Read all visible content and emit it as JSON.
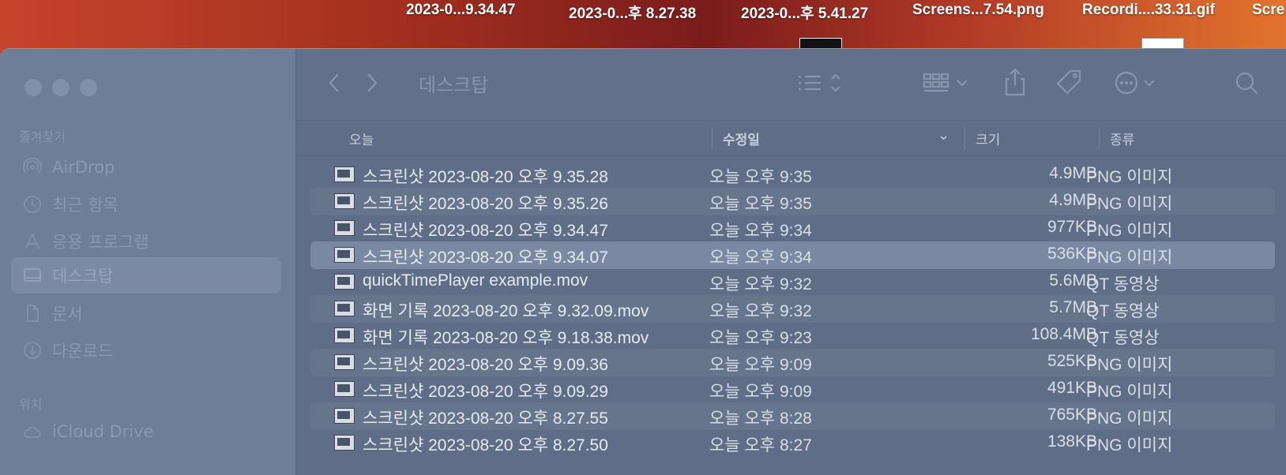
{
  "desktop": {
    "labels": [
      "2023-0...9.34.47",
      "2023-0...후 8.27.38",
      "2023-0...후 5.41.27",
      "Screens...7.54.png",
      "Recordi....33.31.gif",
      "Scre"
    ]
  },
  "sidebar": {
    "favorites_heading": "즐겨찾기",
    "items": [
      {
        "label": "AirDrop",
        "icon": "airdrop-icon"
      },
      {
        "label": "최근 항목",
        "icon": "clock-icon"
      },
      {
        "label": "응용 프로그램",
        "icon": "applications-icon"
      },
      {
        "label": "데스크탑",
        "icon": "desktop-icon",
        "selected": true
      },
      {
        "label": "문서",
        "icon": "document-icon"
      },
      {
        "label": "다운로드",
        "icon": "download-icon"
      }
    ],
    "locations_heading": "위치",
    "locations": [
      {
        "label": "iCloud Drive",
        "icon": "cloud-icon"
      }
    ]
  },
  "toolbar": {
    "title": "데스크탑"
  },
  "columns": {
    "name": "오늘",
    "date": "수정일",
    "size": "크기",
    "kind": "종류"
  },
  "files": [
    {
      "name": "스크린샷 2023-08-20 오후 9.35.28",
      "date": "오늘 오후 9:35",
      "size": "4.9MB",
      "kind": "PNG 이미지"
    },
    {
      "name": "스크린샷 2023-08-20 오후 9.35.26",
      "date": "오늘 오후 9:35",
      "size": "4.9MB",
      "kind": "PNG 이미지"
    },
    {
      "name": "스크린샷 2023-08-20 오후 9.34.47",
      "date": "오늘 오후 9:34",
      "size": "977KB",
      "kind": "PNG 이미지"
    },
    {
      "name": "스크린샷 2023-08-20 오후 9.34.07",
      "date": "오늘 오후 9:34",
      "size": "536KB",
      "kind": "PNG 이미지"
    },
    {
      "name": "quickTimePlayer example.mov",
      "date": "오늘 오후 9:32",
      "size": "5.6MB",
      "kind": "QT 동영상"
    },
    {
      "name": "화면 기록 2023-08-20 오후 9.32.09.mov",
      "date": "오늘 오후 9:32",
      "size": "5.7MB",
      "kind": "QT 동영상"
    },
    {
      "name": "화면 기록 2023-08-20 오후 9.18.38.mov",
      "date": "오늘 오후 9:23",
      "size": "108.4MB",
      "kind": "QT 동영상"
    },
    {
      "name": "스크린샷 2023-08-20 오후 9.09.36",
      "date": "오늘 오후 9:09",
      "size": "525KB",
      "kind": "PNG 이미지"
    },
    {
      "name": "스크린샷 2023-08-20 오후 9.09.29",
      "date": "오늘 오후 9:09",
      "size": "491KB",
      "kind": "PNG 이미지"
    },
    {
      "name": "스크린샷 2023-08-20 오후 8.27.55",
      "date": "오늘 오후 8:28",
      "size": "765KB",
      "kind": "PNG 이미지"
    },
    {
      "name": "스크린샷 2023-08-20 오후 8.27.50",
      "date": "오늘 오후 8:27",
      "size": "138KB",
      "kind": "PNG 이미지"
    }
  ]
}
